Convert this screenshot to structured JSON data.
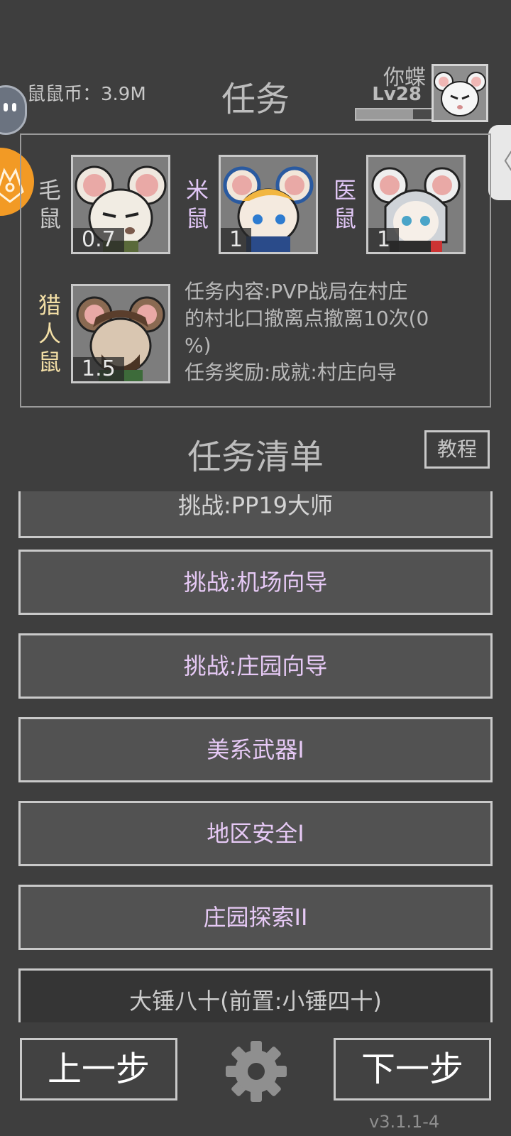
{
  "header": {
    "coins": "鼠鼠币：3.9M",
    "title": "任务",
    "username": "你蝶",
    "level": "Lv28",
    "xp_progress": 0.75
  },
  "team": [
    {
      "name_top": "毛",
      "name_bottom": "鼠",
      "value": "0.7",
      "label_color": "#c8c8c8"
    },
    {
      "name_top": "米",
      "name_bottom": "鼠",
      "value": "1",
      "label_color": "#e0c6f5"
    },
    {
      "name_top": "医",
      "name_bottom": "鼠",
      "value": "1",
      "label_color": "#e0c6f5"
    },
    {
      "name_top": "猎",
      "name_mid": "人",
      "name_bottom": "鼠",
      "value": "1.5",
      "label_color": "#f3dfa6"
    }
  ],
  "task": {
    "content_line1": "任务内容:PVP战局在村庄",
    "content_line2": "的村北口撤离点撤离10次(0",
    "content_line3": "%)",
    "reward": "任务奖励:成就:村庄向导"
  },
  "list": {
    "title": "任务清单",
    "tutorial": "教程",
    "items": [
      {
        "label": "挑战:PP19大师",
        "style": "gray"
      },
      {
        "label": "挑战:机场向导",
        "style": "purple"
      },
      {
        "label": "挑战:庄园向导",
        "style": "purple"
      },
      {
        "label": "美系武器I",
        "style": "purple"
      },
      {
        "label": "地区安全I",
        "style": "purple"
      },
      {
        "label": "庄园探索II",
        "style": "purple"
      },
      {
        "label": "大锤八十(前置:小锤四十)",
        "style": "dark"
      }
    ]
  },
  "bottom": {
    "prev": "上一步",
    "next": "下一步",
    "version": "v3.1.1-4"
  },
  "side": {
    "right_tab_glyph": "〈"
  },
  "colors": {
    "background": "#3e3e3e",
    "accent_purple": "#e6c9f5",
    "accent_gold": "#f3dfa6",
    "side_orange": "#f29a25"
  },
  "icons": [
    "robot-tab-icon",
    "fox-tab-icon",
    "settings-gear-icon",
    "mouse-portrait-icon"
  ]
}
